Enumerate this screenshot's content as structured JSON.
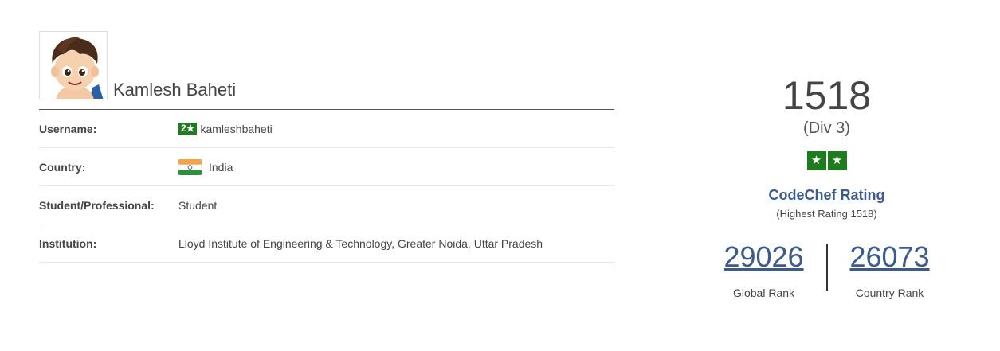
{
  "profile": {
    "name": "Kamlesh Baheti",
    "rows": [
      {
        "label": "Username:",
        "badge": "2★",
        "value": "kamleshbaheti"
      },
      {
        "label": "Country:",
        "value": "India"
      },
      {
        "label": "Student/Professional:",
        "value": "Student"
      },
      {
        "label": "Institution:",
        "value": "Lloyd Institute of Engineering & Technology, Greater Noida, Uttar Pradesh"
      }
    ]
  },
  "rating": {
    "value": "1518",
    "division": "(Div 3)",
    "stars": [
      "★",
      "★"
    ],
    "star_color": "#1e7b1e",
    "link_label": "CodeChef Rating",
    "highest": "(Highest Rating 1518)",
    "global_rank": "29026",
    "global_rank_label": "Global Rank",
    "country_rank": "26073",
    "country_rank_label": "Country Rank"
  },
  "colors": {
    "link": "#3c5a8a",
    "badge": "#1e7b1e"
  },
  "icons": {
    "avatar": "cartoon-boy-avatar",
    "flag": "india-flag-icon"
  }
}
